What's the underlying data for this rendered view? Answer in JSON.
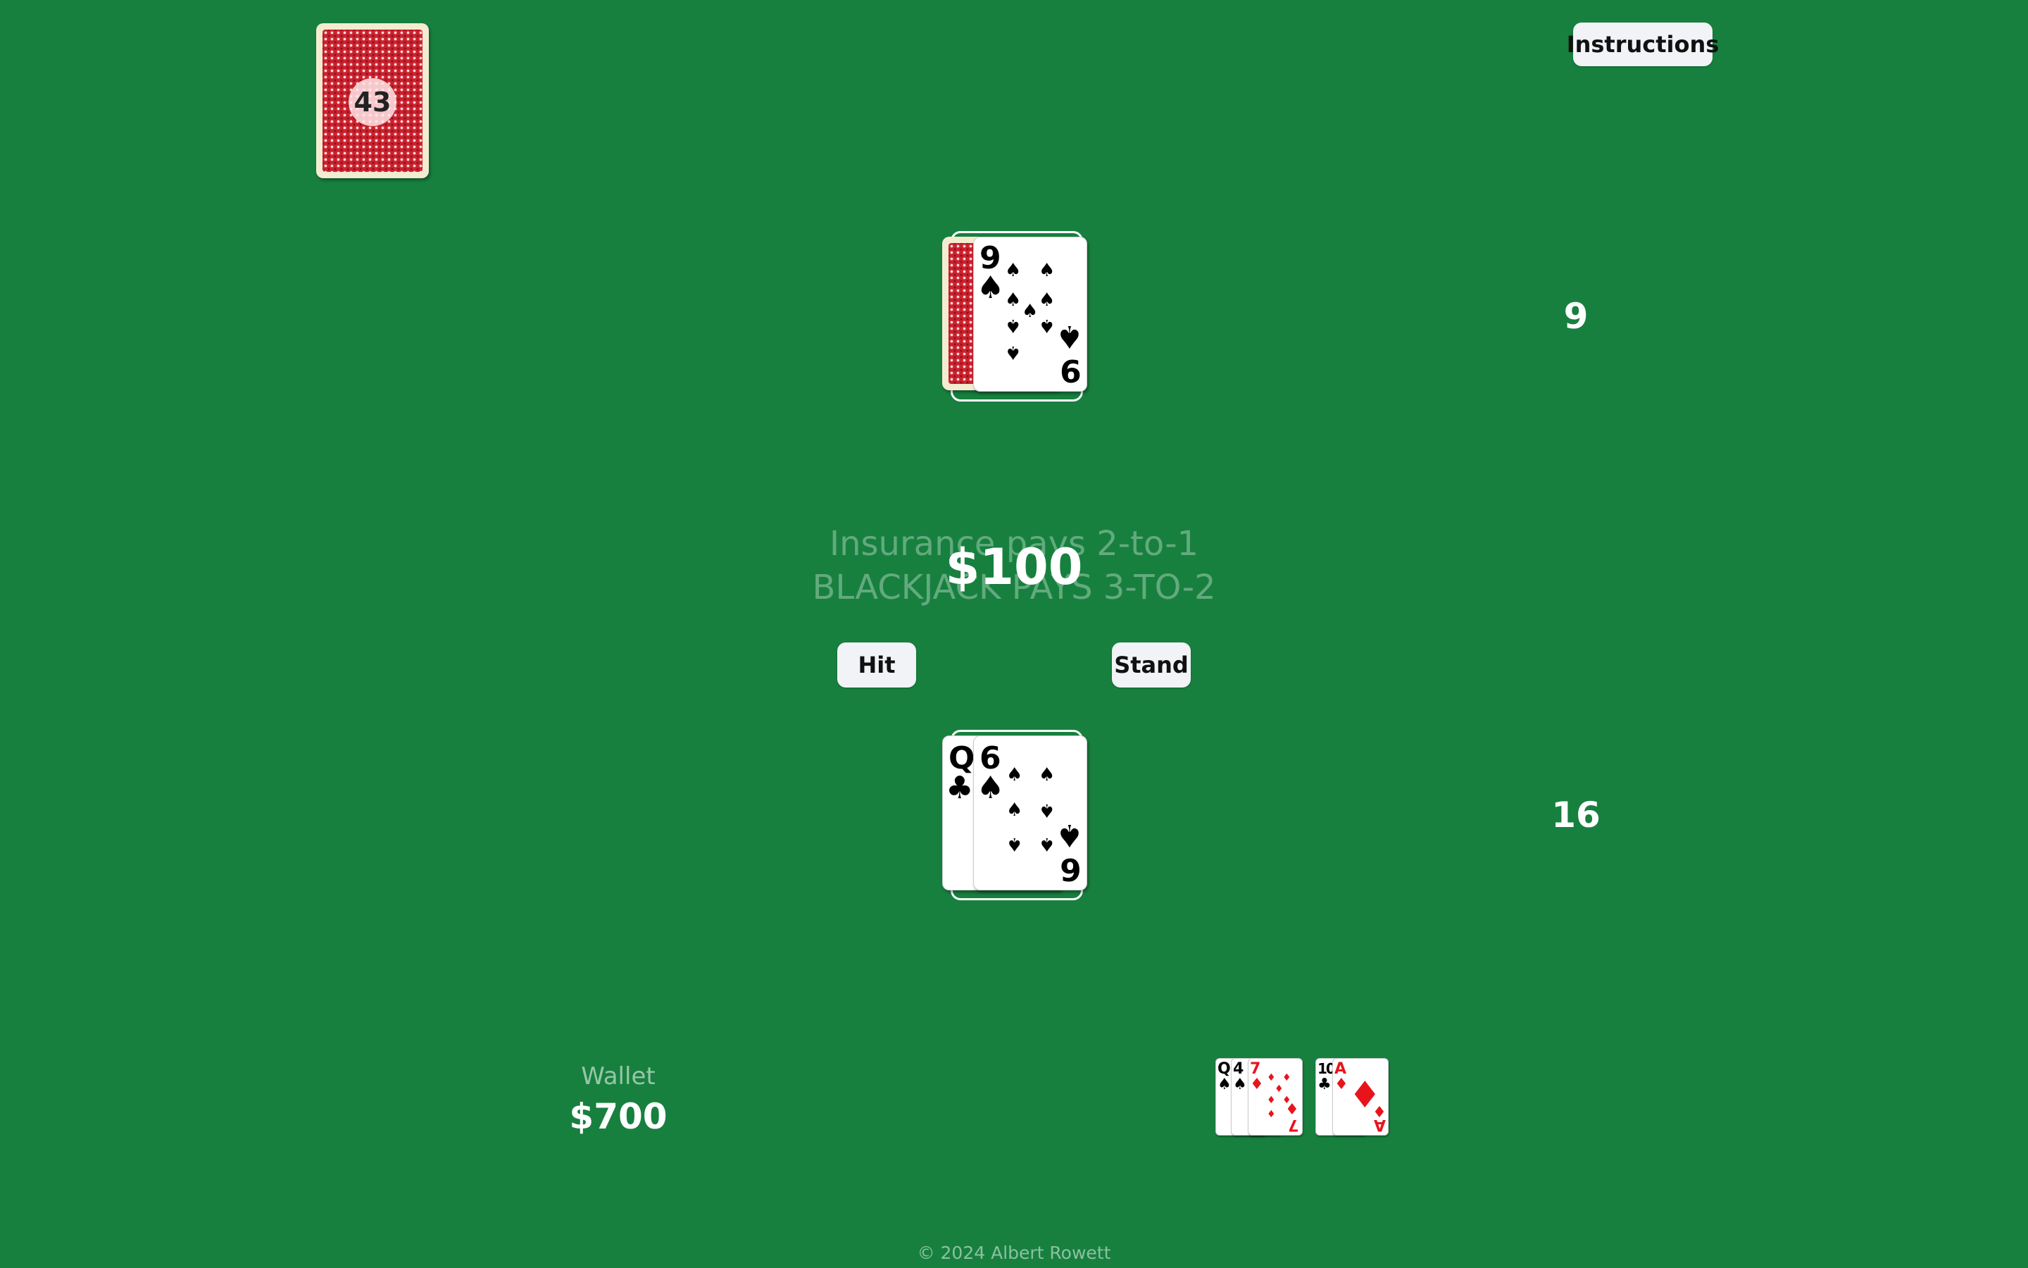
{
  "header": {
    "instructions_label": "Instructions"
  },
  "shoe": {
    "remaining": "43"
  },
  "dealer": {
    "score": "9",
    "cards": [
      {
        "rank": "",
        "suit": "",
        "face_down": true
      },
      {
        "rank": "9",
        "suit": "♠",
        "color": "black"
      }
    ]
  },
  "table": {
    "insurance_text": "Insurance pays 2-to-1",
    "blackjack_text": "BLACKJACK PAYS 3-TO-2",
    "bet": "$100"
  },
  "actions": {
    "hit_label": "Hit",
    "stand_label": "Stand"
  },
  "player": {
    "score": "16",
    "cards": [
      {
        "rank": "Q",
        "suit": "♣",
        "color": "black"
      },
      {
        "rank": "6",
        "suit": "♠",
        "color": "black"
      }
    ]
  },
  "wallet": {
    "label": "Wallet",
    "amount": "$700"
  },
  "discard": {
    "pile1": [
      {
        "rank": "Q",
        "suit": "♠"
      },
      {
        "rank": "4",
        "suit": "♠"
      },
      {
        "rank": "7",
        "suit": "♦"
      }
    ],
    "pile2": [
      {
        "rank": "10",
        "suit": "♣"
      },
      {
        "rank": "A",
        "suit": "♦"
      }
    ]
  },
  "footer": {
    "copyright": "© 2024 Albert Rowett"
  },
  "colors": {
    "felt": "#17803f",
    "card_back": "#c9232f",
    "suit_red": "#e8141c"
  },
  "icons": [
    "card-back-pattern",
    "spade-icon",
    "club-icon",
    "diamond-icon"
  ]
}
